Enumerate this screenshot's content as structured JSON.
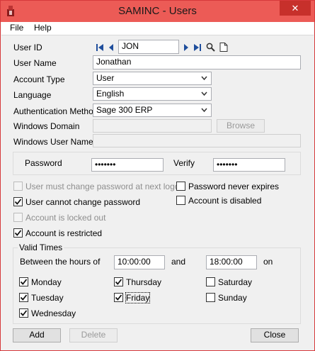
{
  "window": {
    "title": "SAMINC - Users",
    "close_glyph": "✕"
  },
  "menu": {
    "file": "File",
    "help": "Help"
  },
  "form": {
    "user_id_label": "User ID",
    "user_id": "JON",
    "user_name_label": "User Name",
    "user_name": "Jonathan",
    "account_type_label": "Account Type",
    "account_type": "User",
    "language_label": "Language",
    "language": "English",
    "auth_method_label": "Authentication Method",
    "auth_method": "Sage 300 ERP",
    "windows_domain_label": "Windows Domain",
    "windows_domain": "",
    "browse_label": "Browse",
    "windows_user_label": "Windows User Name",
    "windows_user": ""
  },
  "password": {
    "password_label": "Password",
    "password_value": "•••••••",
    "verify_label": "Verify",
    "verify_value": "•••••••"
  },
  "options": {
    "must_change": {
      "label": "User must change password at next logon",
      "checked": false,
      "disabled": true
    },
    "never_expires": {
      "label": "Password never expires",
      "checked": false,
      "disabled": false
    },
    "cannot_change": {
      "label": "User cannot change password",
      "checked": true,
      "disabled": false
    },
    "is_disabled": {
      "label": "Account is disabled",
      "checked": false,
      "disabled": false
    },
    "locked_out": {
      "label": "Account is locked out",
      "checked": false,
      "disabled": true
    },
    "restricted": {
      "label": "Account is restricted",
      "checked": true,
      "disabled": false
    }
  },
  "valid_times": {
    "title": "Valid Times",
    "between_label": "Between the hours of",
    "start": "10:00:00",
    "and_label": "and",
    "end": "18:00:00",
    "on_label": "on",
    "days": {
      "monday": {
        "label": "Monday",
        "checked": true
      },
      "tuesday": {
        "label": "Tuesday",
        "checked": true
      },
      "wednesday": {
        "label": "Wednesday",
        "checked": true
      },
      "thursday": {
        "label": "Thursday",
        "checked": true
      },
      "friday": {
        "label": "Friday",
        "checked": true
      },
      "saturday": {
        "label": "Saturday",
        "checked": false
      },
      "sunday": {
        "label": "Sunday",
        "checked": false
      }
    }
  },
  "buttons": {
    "add": "Add",
    "delete": "Delete",
    "close": "Close"
  },
  "icons": {
    "app": "sage-app-icon",
    "first": "first-record-icon",
    "prev": "previous-record-icon",
    "next": "next-record-icon",
    "last": "last-record-icon",
    "finder": "search-icon",
    "new": "new-document-icon"
  },
  "colors": {
    "titlebar": "#ec5b56",
    "close_button": "#c7302b",
    "nav_icon": "#1f4e9c"
  }
}
